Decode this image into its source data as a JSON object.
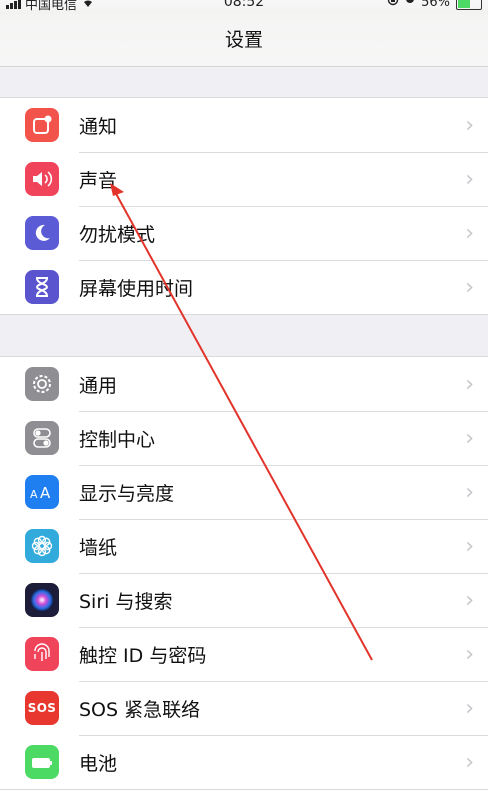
{
  "status_bar": {
    "carrier": "中国电信",
    "time": "08:52",
    "battery": "56%",
    "battery_level": 0.56
  },
  "nav": {
    "title": "设置"
  },
  "group1": [
    {
      "label": "通知",
      "icon": "notification-icon",
      "color": "#f2534a"
    },
    {
      "label": "声音",
      "icon": "speaker-icon",
      "color": "#f0445b"
    },
    {
      "label": "勿扰模式",
      "icon": "moon-icon",
      "color": "#5b5bd6"
    },
    {
      "label": "屏幕使用时间",
      "icon": "hourglass-icon",
      "color": "#5a54cf"
    }
  ],
  "group2": [
    {
      "label": "通用",
      "icon": "gear-icon",
      "color": "#8e8e93"
    },
    {
      "label": "控制中心",
      "icon": "toggle-icon",
      "color": "#8e8e93"
    },
    {
      "label": "显示与亮度",
      "icon": "text-size-icon",
      "color": "#1f7ff0"
    },
    {
      "label": "墙纸",
      "icon": "flower-icon",
      "color": "#32aadc"
    },
    {
      "label": "Siri 与搜索",
      "icon": "siri-icon",
      "color": "#1d1d3a"
    },
    {
      "label": "触控 ID 与密码",
      "icon": "fingerprint-icon",
      "color": "#f0445b"
    },
    {
      "label": "SOS 紧急联络",
      "icon": "sos-icon",
      "color": "#e7372f",
      "icon_text": "SOS"
    },
    {
      "label": "电池",
      "icon": "battery-icon",
      "color": "#4cd964"
    }
  ],
  "chevron": "›"
}
